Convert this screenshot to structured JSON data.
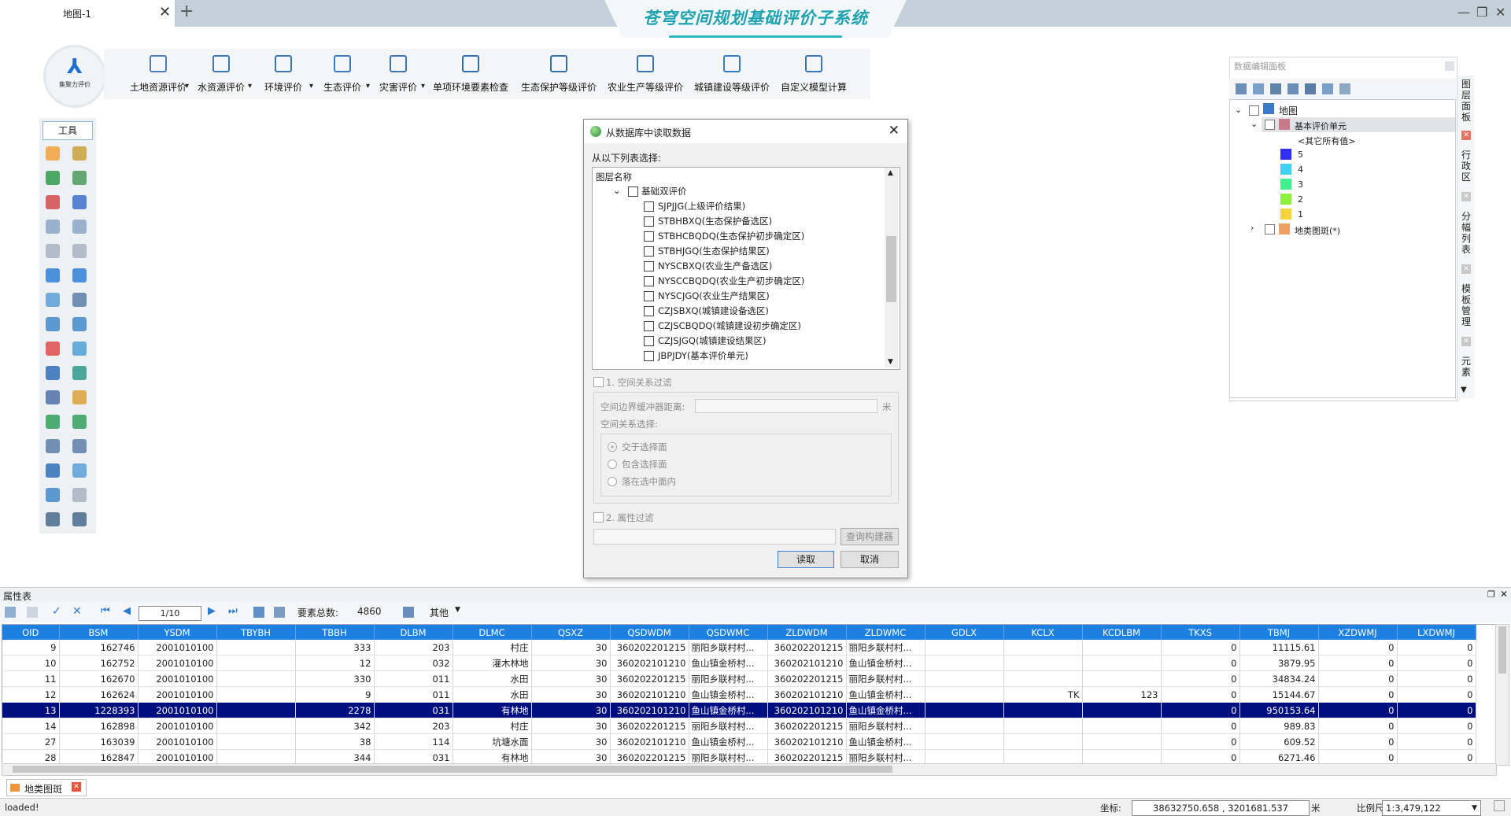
{
  "tab": {
    "title": "地图-1",
    "close": "✕",
    "new": "+"
  },
  "app_title": "苍穹空间规划基础评价子系统",
  "window": {
    "min": "—",
    "max": "❐",
    "close": "✕"
  },
  "logo": {
    "glyph": "⅄",
    "text": "集聚力评价"
  },
  "ribbon": [
    {
      "label": "土地资源评价",
      "icon": "land-eval-icon",
      "dropdown": true
    },
    {
      "label": "水资源评价",
      "icon": "water-eval-icon",
      "dropdown": true
    },
    {
      "label": "环境评价",
      "icon": "env-eval-icon",
      "dropdown": true
    },
    {
      "label": "生态评价",
      "icon": "eco-eval-icon",
      "dropdown": true
    },
    {
      "label": "灾害评价",
      "icon": "disaster-eval-icon",
      "dropdown": true
    },
    {
      "label": "单项环境要素检查",
      "icon": "single-check-icon",
      "dropdown": false
    },
    {
      "label": "生态保护等级评价",
      "icon": "eco-grade-icon",
      "dropdown": false
    },
    {
      "label": "农业生产等级评价",
      "icon": "agri-grade-icon",
      "dropdown": false
    },
    {
      "label": "城镇建设等级评价",
      "icon": "urban-grade-icon",
      "dropdown": false
    },
    {
      "label": "自定义模型计算",
      "icon": "custom-model-icon",
      "dropdown": false
    }
  ],
  "tools": {
    "header": "工具",
    "icons": [
      "open-folder-icon",
      "import-icon",
      "save-icon",
      "save-layer-icon",
      "delete-feature-icon",
      "select-icon",
      "copy-icon",
      "paste-icon",
      "undo-icon",
      "redo-icon",
      "info-icon",
      "identify-icon",
      "globe-grid-icon",
      "measure-icon",
      "add-layer-icon",
      "pan-extent-icon",
      "edit-line-icon",
      "split-icon",
      "layers-icon",
      "polygon-icon",
      "trash-icon",
      "eraser-icon",
      "zoom-in-icon",
      "zoom-out-icon",
      "full-extent-icon",
      "fit-icon",
      "globe-icon",
      "refresh-icon",
      "prev-view-icon",
      "next-view-icon",
      "cut-icon",
      "hand-icon"
    ]
  },
  "dialog": {
    "title": "从数据库中读取数据",
    "list_label": "从以下列表选择:",
    "column_header": "图层名称",
    "group": "基础双评价",
    "layers": [
      "SJPJJG(上级评价结果)",
      "STBHBXQ(生态保护备选区)",
      "STBHCBQDQ(生态保护初步确定区)",
      "STBHJGQ(生态保护结果区)",
      "NYSCBXQ(农业生产备选区)",
      "NYSCCBQDQ(农业生产初步确定区)",
      "NYSCJGQ(农业生产结果区)",
      "CZJSBXQ(城镇建设备选区)",
      "CZJSCBQDQ(城镇建设初步确定区)",
      "CZJSJGQ(城镇建设结果区)",
      "JBPJDY(基本评价单元)"
    ],
    "spatial_filter": "1. 空间关系过滤",
    "buffer_label": "空间边界缓冲器距离:",
    "buffer_unit": "米",
    "relation_label": "空间关系选择:",
    "relations": [
      "交于选择面",
      "包含选择面",
      "落在选中面内"
    ],
    "attr_filter": "2. 属性过滤",
    "query_builder": "查询构建器",
    "read": "读取",
    "cancel": "取消"
  },
  "right_panel": {
    "title": "数据编辑面板",
    "root": "地图",
    "layer": "基本评价单元",
    "other": "<其它所有值>",
    "legend": [
      {
        "label": "5",
        "color": "#2f2ff2"
      },
      {
        "label": "4",
        "color": "#3fd0f2"
      },
      {
        "label": "3",
        "color": "#3ff08c"
      },
      {
        "label": "2",
        "color": "#8cf03f"
      },
      {
        "label": "1",
        "color": "#f7d23a"
      }
    ],
    "layer2": "地类图斑(*)",
    "side_tabs": [
      "图层面板",
      "行政区",
      "分幅列表",
      "模板管理",
      "元素"
    ]
  },
  "attr": {
    "title": "属性表",
    "page": "1/10",
    "total_label": "要素总数:",
    "total": "4860",
    "other": "其他",
    "columns": [
      "OID",
      "BSM",
      "YSDM",
      "TBYBH",
      "TBBH",
      "DLBM",
      "DLMC",
      "QSXZ",
      "QSDWDM",
      "QSDWMC",
      "ZLDWDM",
      "ZLDWMC",
      "GDLX",
      "KCLX",
      "KCDLBM",
      "TKXS",
      "TBMJ",
      "XZDWMJ",
      "LXDWMJ"
    ],
    "rows": [
      [
        "9",
        "162746",
        "2001010100",
        "",
        "333",
        "203",
        "村庄",
        "30",
        "360202201215",
        "丽阳乡联村村...",
        "360202201215",
        "丽阳乡联村村...",
        "",
        "",
        "",
        "0",
        "11115.61",
        "0",
        "0"
      ],
      [
        "10",
        "162752",
        "2001010100",
        "",
        "12",
        "032",
        "灌木林地",
        "30",
        "360202101210",
        "鱼山镇金桥村...",
        "360202101210",
        "鱼山镇金桥村...",
        "",
        "",
        "",
        "0",
        "3879.95",
        "0",
        "0"
      ],
      [
        "11",
        "162670",
        "2001010100",
        "",
        "330",
        "011",
        "水田",
        "30",
        "360202201215",
        "丽阳乡联村村...",
        "360202201215",
        "丽阳乡联村村...",
        "",
        "",
        "",
        "0",
        "34834.24",
        "0",
        "0"
      ],
      [
        "12",
        "162624",
        "2001010100",
        "",
        "9",
        "011",
        "水田",
        "30",
        "360202101210",
        "鱼山镇金桥村...",
        "360202101210",
        "鱼山镇金桥村...",
        "",
        "TK",
        "123",
        "0",
        "15144.67",
        "0",
        "0"
      ],
      [
        "13",
        "1228393",
        "2001010100",
        "",
        "2278",
        "031",
        "有林地",
        "30",
        "360202101210",
        "鱼山镇金桥村...",
        "360202101210",
        "鱼山镇金桥村...",
        "",
        "",
        "",
        "0",
        "950153.64",
        "0",
        "0"
      ],
      [
        "14",
        "162898",
        "2001010100",
        "",
        "342",
        "203",
        "村庄",
        "30",
        "360202201215",
        "丽阳乡联村村...",
        "360202201215",
        "丽阳乡联村村...",
        "",
        "",
        "",
        "0",
        "989.83",
        "0",
        "0"
      ],
      [
        "27",
        "163039",
        "2001010100",
        "",
        "38",
        "114",
        "坑塘水面",
        "30",
        "360202101210",
        "鱼山镇金桥村...",
        "360202101210",
        "鱼山镇金桥村...",
        "",
        "",
        "",
        "0",
        "609.52",
        "0",
        "0"
      ],
      [
        "28",
        "162847",
        "2001010100",
        "",
        "344",
        "031",
        "有林地",
        "30",
        "360202201215",
        "丽阳乡联村村...",
        "360202201215",
        "丽阳乡联村村...",
        "",
        "",
        "",
        "0",
        "6271.46",
        "0",
        "0"
      ]
    ],
    "selected_row": 4
  },
  "bottom_tab": "地类图斑",
  "status": {
    "text": "loaded!",
    "coord_label": "坐标:",
    "coord": "38632750.658 , 3201681.537",
    "unit": "米",
    "scale_label": "比例尺",
    "scale": "1:3,479,122"
  },
  "colors": {
    "accent": "#1d7fe0",
    "selected_row": "#000f80",
    "brand": "#1fa3b0"
  }
}
